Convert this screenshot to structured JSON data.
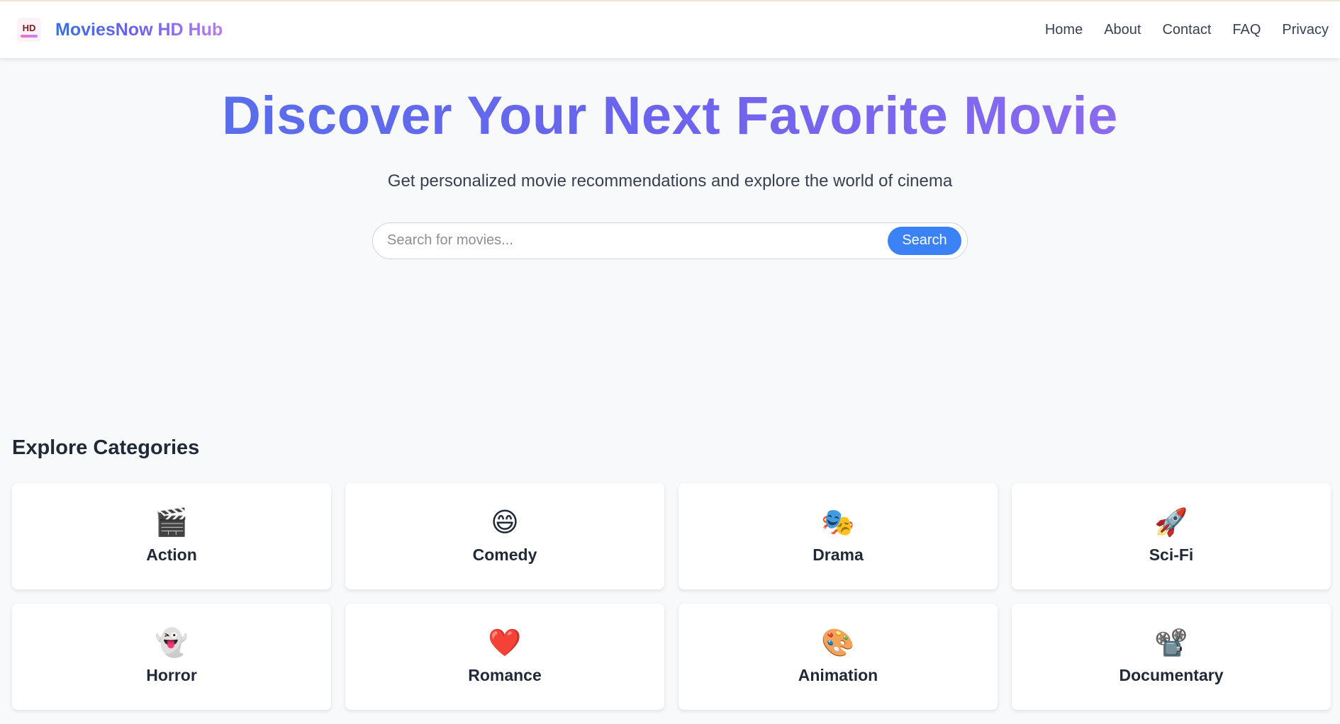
{
  "brand": {
    "name": "MoviesNow HD Hub",
    "logo_text": "HD",
    "logo_icon": "movie-logo-icon"
  },
  "nav": [
    "Home",
    "About",
    "Contact",
    "FAQ",
    "Privacy"
  ],
  "hero": {
    "title": "Discover Your Next Favorite Movie",
    "subtitle": "Get personalized movie recommendations and explore the world of cinema"
  },
  "search": {
    "placeholder": "Search for movies...",
    "value": "",
    "button_label": "Search"
  },
  "categories": {
    "heading": "Explore Categories",
    "items": [
      {
        "label": "Action",
        "icon": "🎬",
        "icon_name": "clapperboard-icon"
      },
      {
        "label": "Comedy",
        "icon": "😄",
        "icon_name": "laughing-face-icon"
      },
      {
        "label": "Drama",
        "icon": "🎭",
        "icon_name": "theater-masks-icon"
      },
      {
        "label": "Sci-Fi",
        "icon": "🚀",
        "icon_name": "rocket-icon"
      },
      {
        "label": "Horror",
        "icon": "👻",
        "icon_name": "ghost-icon"
      },
      {
        "label": "Romance",
        "icon": "❤️",
        "icon_name": "heart-icon"
      },
      {
        "label": "Animation",
        "icon": "🎨",
        "icon_name": "palette-icon"
      },
      {
        "label": "Documentary",
        "icon": "📽️",
        "icon_name": "film-projector-icon"
      }
    ]
  },
  "colors": {
    "accent": "#3b82f6",
    "brand_start": "#3b6fe0",
    "brand_end": "#b77ef0"
  }
}
